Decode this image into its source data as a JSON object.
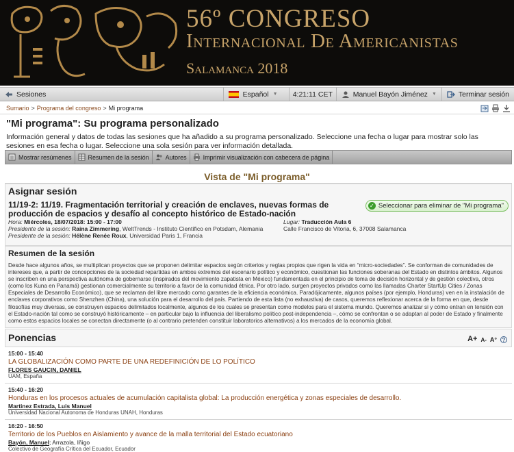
{
  "banner": {
    "line1": "56º CONGRESO",
    "line2": "Internacional De Americanistas",
    "line3": "Salamanca 2018"
  },
  "topbar": {
    "sessions": "Sesiones",
    "language": "Español",
    "time": "4:21:11 CET",
    "user": "Manuel Bayón Jiménez",
    "logout": "Terminar sesión"
  },
  "breadcrumb": {
    "items": [
      "Sumario",
      "Programa del congreso",
      "Mi programa"
    ],
    "separator": ">"
  },
  "page": {
    "title": "\"Mi programa\": Su programa personalizado",
    "intro": "Información general y datos de todas las sesiones que ha añadido a su programa personalizado. Seleccione una fecha o lugar para mostrar solo las sesiones en esa fecha o lugar. Seleccione una sola sesión para ver información detallada."
  },
  "toolbar": {
    "show_summaries": "Mostrar resúmenes",
    "session_summary": "Resumen de la sesión",
    "authors": "Autores",
    "print_header": "Imprimir visualización con cabecera de página"
  },
  "vista": "Vista de \"Mi programa\"",
  "assign": {
    "heading": "Asignar sesión",
    "session_title": "11/19-2: 11/19. Fragmentación territorial y creación de enclaves, nuevas formas de producción de espacios y desafío al concepto histórico de Estado-nación",
    "select_button": "Seleccionar para eliminar de \"Mi programa\"",
    "time_label": "Hora:",
    "time_value": "Miércoles, 18/07/2018: 15:00 - 17:00",
    "president1_label": "Presidente de la sesión:",
    "president1_name": "Raina Zimmering",
    "president1_aff": ", WeltTrends - Instituto Científico en Potsdam, Alemania",
    "president2_label": "Presidente de la sesión:",
    "president2_name": "Hélène Renée Roux",
    "president2_aff": ", Universidad Paris 1, Francia",
    "place_label": "Lugar:",
    "place_value": "Traducción Aula 6",
    "address": "Calle Francisco de Vitoria, 6, 37008 Salamanca"
  },
  "summary": {
    "heading": "Resumen de la sesión",
    "text": "Desde hace algunos años, se multiplican proyectos que se proponen delimitar espacios según criterios y reglas propios que rigen la vida en “micro-sociedades”. Se conforman de comunidades de intereses que, a partir de concepciones de la sociedad repartidas en ambos extremos del escenario político y económico, cuestionan las funciones soberanas del Estado en distintos ámbitos. Algunos se inscriben en una perspectiva autónoma de gobernarse (inspirados del movimiento zapatista en México) fundamentada en el principio de toma de decisión horizontal y de gestión colectiva, otros (como los Kuna en Panamá) gestionan comercialmente su territorio a favor de la comunidad étnica. Por otro lado, surgen proyectos privados como las llamadas Charter StartUp Cities / Zonas Especiales de Desarrollo Económico), que se reclaman del libre mercado como garantes de la eficiencia económica. Paradójicamente, algunos países (por ejemplo, Honduras) ven en la instalación de enclaves corporativos como Shenzhen (China), una solución para el desarrollo del país. Partiendo de esta lista (no exhaustiva) de casos, queremos reflexionar acerca de la forma en que, desde filosofías muy diversas, se construyen espacios delimitados localmente, algunos de los cuales se presentan como modelos para el sistema mundo. Queremos analizar si y cómo entran en tensión con el Estado-nación tal como se construyó históricamente – en particular bajo la influencia del liberalismo político post-independencia –, cómo se confrontan o se adaptan al poder de Estado y finalmente como estos espacios locales se conectan directamente (o al contrario pretenden constituir laboratorios alternativos) a los mercados de la economía global."
  },
  "ponencias": {
    "heading": "Ponencias",
    "font_tools": [
      "A+",
      "A-",
      "A°",
      "?"
    ],
    "items": [
      {
        "time": "15:00 - 15:40",
        "title": "LA GLOBALIZACIÓN COMO PARTE DE UNA REDEFINICIÓN DE LO POLÍTICO",
        "authors": "FLORES GAUCIN, DANIEL",
        "extra_authors": "",
        "affiliation": "UAM, España"
      },
      {
        "time": "15:40 - 16:20",
        "title": "Honduras en los procesos actuales de acumulación capitalista global: La producción energética y zonas especiales de desarrollo.",
        "authors": "Martinez Estrada, Luis Manuel",
        "extra_authors": "",
        "affiliation": "Universidad Nacional Autonoma de Honduras UNAH, Honduras"
      },
      {
        "time": "16:20 - 16:50",
        "title": "Territorio de los Pueblos en Aislamiento y avance de la malla territorial del Estado ecuatoriano",
        "authors": "Bayón, Manuel",
        "extra_authors": "; Arrazola, Iñigo",
        "affiliation": "Colectivo de Geografía Crítica del Ecuador, Ecuador"
      }
    ]
  },
  "colors": {
    "banner_bg": "#0d0c0a",
    "banner_gold": "#c8a46a",
    "link": "#8a4a1d",
    "talk_title": "#8a3f10",
    "vista_heading": "#7b5d2a",
    "select_green": "#3c9d2b"
  }
}
